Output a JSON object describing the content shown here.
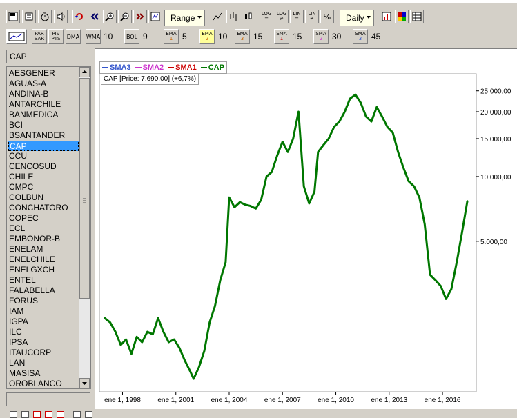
{
  "toolbar": {
    "range_label": "Range",
    "period_label": "Daily",
    "log_label": "LOG",
    "lin_label": "LIN",
    "percent_label": "%"
  },
  "indicators": {
    "par_sar": [
      "PAR",
      "SAR"
    ],
    "piv_pts": [
      "PIV",
      "PTS"
    ],
    "dma": "DMA",
    "wma": {
      "label": "WMA",
      "value": "10"
    },
    "bol": {
      "label": "BOL",
      "value": "9"
    },
    "ema1": {
      "label": "EMA",
      "idx": "1",
      "value": "5"
    },
    "ema2": {
      "label": "EMA",
      "idx": "2",
      "value": "10"
    },
    "ema3": {
      "label": "EMA",
      "idx": "3",
      "value": "15"
    },
    "sma1": {
      "label": "SMA",
      "idx": "1",
      "value": "15"
    },
    "sma2": {
      "label": "SMA",
      "idx": "2",
      "value": "30"
    },
    "sma3": {
      "label": "SMA",
      "idx": "3",
      "value": "45"
    }
  },
  "symbol_input": "CAP",
  "symbols": [
    "AESGENER",
    "AGUAS-A",
    "ANDINA-B",
    "ANTARCHILE",
    "BANMEDICA",
    "BCI",
    "BSANTANDER",
    "CAP",
    "CCU",
    "CENCOSUD",
    "CHILE",
    "CMPC",
    "COLBUN",
    "CONCHATORO",
    "COPEC",
    "ECL",
    "EMBONOR-B",
    "ENELAM",
    "ENELCHILE",
    "ENELGXCH",
    "ENTEL",
    "FALABELLA",
    "FORUS",
    "IAM",
    "IGPA",
    "ILC",
    "IPSA",
    "ITAUCORP",
    "LAN",
    "MASISA",
    "OROBLANCO"
  ],
  "selected_symbol_index": 7,
  "legend": [
    {
      "name": "SMA3",
      "color": "#3355cc"
    },
    {
      "name": "SMA2",
      "color": "#cc33cc"
    },
    {
      "name": "SMA1",
      "color": "#cc0000"
    },
    {
      "name": "CAP",
      "color": "#007700"
    }
  ],
  "price_label": "CAP [Price: 7.690,00] (+6,7%)",
  "chart_data": {
    "type": "line",
    "title": "",
    "yscale": "log",
    "ylim": [
      1000,
      30000
    ],
    "y_ticks": [
      5000,
      10000,
      15000,
      20000,
      25000
    ],
    "y_tick_labels": [
      "5.000,00",
      "10.000,00",
      "15.000,00",
      "20.000,00",
      "25.000,00"
    ],
    "xlim": [
      1996.7,
      2017.9
    ],
    "x_ticks": [
      1998,
      2001,
      2004,
      2007,
      2010,
      2013,
      2016
    ],
    "x_tick_labels": [
      "ene 1, 1998",
      "ene 1, 2001",
      "ene 1, 2004",
      "ene 1, 2007",
      "ene 1, 2010",
      "ene 1, 2013",
      "ene 1, 2016"
    ],
    "series": [
      {
        "name": "CAP",
        "color": "#007700",
        "x": [
          1997.0,
          1997.3,
          1997.6,
          1997.9,
          1998.2,
          1998.5,
          1998.8,
          1999.1,
          1999.4,
          1999.7,
          2000.0,
          2000.3,
          2000.6,
          2000.9,
          2001.2,
          2001.5,
          2001.8,
          2002.0,
          2002.3,
          2002.6,
          2002.9,
          2003.2,
          2003.5,
          2003.8,
          2004.0,
          2004.3,
          2004.6,
          2004.9,
          2005.2,
          2005.5,
          2005.8,
          2006.1,
          2006.4,
          2006.7,
          2007.0,
          2007.3,
          2007.6,
          2007.9,
          2008.2,
          2008.5,
          2008.8,
          2009.0,
          2009.3,
          2009.6,
          2009.9,
          2010.2,
          2010.5,
          2010.8,
          2011.1,
          2011.4,
          2011.7,
          2012.0,
          2012.3,
          2012.6,
          2012.9,
          2013.2,
          2013.5,
          2013.8,
          2014.1,
          2014.4,
          2014.7,
          2015.0,
          2015.3,
          2015.6,
          2015.9,
          2016.2,
          2016.5,
          2016.8,
          2017.1,
          2017.4
        ],
        "values": [
          2200,
          2100,
          1900,
          1650,
          1750,
          1500,
          1800,
          1700,
          1900,
          1850,
          2200,
          1900,
          1700,
          1750,
          1600,
          1400,
          1250,
          1150,
          1300,
          1550,
          2100,
          2500,
          3300,
          4000,
          8000,
          7200,
          7600,
          7400,
          7300,
          7100,
          7800,
          10000,
          10500,
          12500,
          14500,
          13000,
          15000,
          20000,
          9000,
          7500,
          8500,
          13000,
          14000,
          15000,
          17000,
          18000,
          20000,
          23000,
          24000,
          22000,
          19000,
          18000,
          21000,
          19000,
          17000,
          16000,
          13000,
          11000,
          9500,
          9000,
          8000,
          6000,
          3500,
          3300,
          3100,
          2700,
          3000,
          4000,
          5500,
          7690
        ]
      }
    ]
  }
}
